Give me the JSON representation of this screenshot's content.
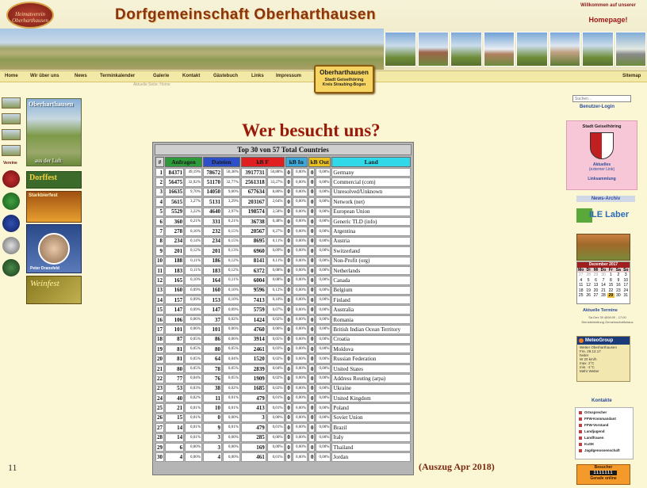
{
  "header": {
    "logo_text": "Heimatverein Oberharthausen",
    "title": "Dorfgemeinschaft Oberharthausen",
    "welcome": "Willkommen auf unserer",
    "homepage": "Homepage!"
  },
  "nav": {
    "items": [
      "Home",
      "Wir über uns",
      "News",
      "Terminkalender",
      "Galerie",
      "Kontakt",
      "Gästebuch",
      "Links",
      "Impressum"
    ],
    "sitemap": "Sitemap",
    "breadcrumb": "Aktuelle Seite: Home"
  },
  "place_box": {
    "title": "Oberharthausen",
    "sub1": "Stadt Geiselhöring",
    "sub2": "Kreis Straubing-Bogen"
  },
  "left": {
    "verein_label": "Vereine",
    "promo_village_title": "Oberharthausen",
    "promo_village_sub": "aus der Luft",
    "promo_dorffest": "Dorffest",
    "promo_starkbier": "Starkbierfest",
    "promo_preacher_name": "Peter Dransfeld",
    "promo_weinfest": "Weinfest"
  },
  "main": {
    "heading": "Wer besucht uns?",
    "excerpt_note": "(Auszug Apr 2018)",
    "page_number": "11"
  },
  "stats": {
    "title": "Top 30 von 57 Total Countries",
    "headers": {
      "rank": "#",
      "requests": "Anfragen",
      "files": "Dateien",
      "kbf": "kB F",
      "kbin": "kB In",
      "kbout": "kB Out",
      "land": "Land"
    },
    "rows": [
      {
        "n": "1",
        "req": "84371",
        "reqp": "49,19%",
        "files": "78672",
        "filesp": "50,38%",
        "kb": "3917731",
        "kbp": "50,88%",
        "in": "0",
        "inp": "0,00%",
        "out": "0",
        "outp": "0,00%",
        "land": "Germany"
      },
      {
        "n": "2",
        "req": "56475",
        "reqp": "32,92%",
        "files": "51170",
        "filesp": "32,77%",
        "kb": "2561318",
        "kbp": "33,27%",
        "in": "0",
        "inp": "0,00%",
        "out": "0",
        "outp": "0,00%",
        "land": "Commercial (com)"
      },
      {
        "n": "3",
        "req": "16635",
        "reqp": "9,70%",
        "files": "14050",
        "filesp": "9,00%",
        "kb": "677634",
        "kbp": "8,80%",
        "in": "0",
        "inp": "0,00%",
        "out": "0",
        "outp": "0,00%",
        "land": "Unresolved/Unknown"
      },
      {
        "n": "4",
        "req": "5615",
        "reqp": "3,27%",
        "files": "5131",
        "filesp": "3,29%",
        "kb": "203167",
        "kbp": "2,64%",
        "in": "0",
        "inp": "0,00%",
        "out": "0",
        "outp": "0,00%",
        "land": "Network (net)"
      },
      {
        "n": "5",
        "req": "5529",
        "reqp": "3,22%",
        "files": "4640",
        "filesp": "2,97%",
        "kb": "198574",
        "kbp": "2,58%",
        "in": "0",
        "inp": "0,00%",
        "out": "0",
        "outp": "0,00%",
        "land": "European Union"
      },
      {
        "n": "6",
        "req": "360",
        "reqp": "0,21%",
        "files": "331",
        "filesp": "0,21%",
        "kb": "36738",
        "kbp": "0,48%",
        "in": "0",
        "inp": "0,00%",
        "out": "0",
        "outp": "0,00%",
        "land": "Generic TLD (info)"
      },
      {
        "n": "7",
        "req": "278",
        "reqp": "0,16%",
        "files": "232",
        "filesp": "0,15%",
        "kb": "20567",
        "kbp": "0,27%",
        "in": "0",
        "inp": "0,00%",
        "out": "0",
        "outp": "0,00%",
        "land": "Argentina"
      },
      {
        "n": "8",
        "req": "234",
        "reqp": "0,14%",
        "files": "234",
        "filesp": "0,15%",
        "kb": "8695",
        "kbp": "0,11%",
        "in": "0",
        "inp": "0,00%",
        "out": "0",
        "outp": "0,00%",
        "land": "Austria"
      },
      {
        "n": "9",
        "req": "201",
        "reqp": "0,12%",
        "files": "201",
        "filesp": "0,13%",
        "kb": "6960",
        "kbp": "0,09%",
        "in": "0",
        "inp": "0,00%",
        "out": "0",
        "outp": "0,00%",
        "land": "Switzerland"
      },
      {
        "n": "10",
        "req": "188",
        "reqp": "0,11%",
        "files": "186",
        "filesp": "0,12%",
        "kb": "8141",
        "kbp": "0,11%",
        "in": "0",
        "inp": "0,00%",
        "out": "0",
        "outp": "0,00%",
        "land": "Non-Profit (org)"
      },
      {
        "n": "11",
        "req": "183",
        "reqp": "0,11%",
        "files": "183",
        "filesp": "0,12%",
        "kb": "6372",
        "kbp": "0,08%",
        "in": "0",
        "inp": "0,00%",
        "out": "0",
        "outp": "0,00%",
        "land": "Netherlands"
      },
      {
        "n": "12",
        "req": "165",
        "reqp": "0,10%",
        "files": "164",
        "filesp": "0,11%",
        "kb": "6004",
        "kbp": "0,08%",
        "in": "0",
        "inp": "0,00%",
        "out": "0",
        "outp": "0,00%",
        "land": "Canada"
      },
      {
        "n": "13",
        "req": "160",
        "reqp": "0,09%",
        "files": "160",
        "filesp": "0,10%",
        "kb": "9596",
        "kbp": "0,12%",
        "in": "0",
        "inp": "0,00%",
        "out": "0",
        "outp": "0,00%",
        "land": "Belgium"
      },
      {
        "n": "14",
        "req": "157",
        "reqp": "0,09%",
        "files": "153",
        "filesp": "0,10%",
        "kb": "7413",
        "kbp": "0,10%",
        "in": "0",
        "inp": "0,00%",
        "out": "0",
        "outp": "0,00%",
        "land": "Finland"
      },
      {
        "n": "15",
        "req": "147",
        "reqp": "0,09%",
        "files": "147",
        "filesp": "0,09%",
        "kb": "5759",
        "kbp": "0,07%",
        "in": "0",
        "inp": "0,00%",
        "out": "0",
        "outp": "0,00%",
        "land": "Australia"
      },
      {
        "n": "16",
        "req": "106",
        "reqp": "0,06%",
        "files": "37",
        "filesp": "0,02%",
        "kb": "1424",
        "kbp": "0,02%",
        "in": "0",
        "inp": "0,00%",
        "out": "0",
        "outp": "0,00%",
        "land": "Romania"
      },
      {
        "n": "17",
        "req": "101",
        "reqp": "0,06%",
        "files": "101",
        "filesp": "0,06%",
        "kb": "4760",
        "kbp": "0,06%",
        "in": "0",
        "inp": "0,00%",
        "out": "0",
        "outp": "0,00%",
        "land": "British Indian Ocean Territory"
      },
      {
        "n": "18",
        "req": "87",
        "reqp": "0,05%",
        "files": "86",
        "filesp": "0,06%",
        "kb": "3914",
        "kbp": "0,05%",
        "in": "0",
        "inp": "0,00%",
        "out": "0",
        "outp": "0,00%",
        "land": "Croatia"
      },
      {
        "n": "19",
        "req": "81",
        "reqp": "0,05%",
        "files": "80",
        "filesp": "0,05%",
        "kb": "2461",
        "kbp": "0,03%",
        "in": "0",
        "inp": "0,00%",
        "out": "0",
        "outp": "0,00%",
        "land": "Moldova"
      },
      {
        "n": "20",
        "req": "81",
        "reqp": "0,05%",
        "files": "64",
        "filesp": "0,04%",
        "kb": "1520",
        "kbp": "0,02%",
        "in": "0",
        "inp": "0,00%",
        "out": "0",
        "outp": "0,00%",
        "land": "Russian Federation"
      },
      {
        "n": "21",
        "req": "80",
        "reqp": "0,05%",
        "files": "78",
        "filesp": "0,05%",
        "kb": "2839",
        "kbp": "0,04%",
        "in": "0",
        "inp": "0,00%",
        "out": "0",
        "outp": "0,00%",
        "land": "United States"
      },
      {
        "n": "22",
        "req": "77",
        "reqp": "0,04%",
        "files": "76",
        "filesp": "0,05%",
        "kb": "1909",
        "kbp": "0,02%",
        "in": "0",
        "inp": "0,00%",
        "out": "0",
        "outp": "0,00%",
        "land": "Address Routing (arpa)"
      },
      {
        "n": "23",
        "req": "53",
        "reqp": "0,03%",
        "files": "38",
        "filesp": "0,02%",
        "kb": "1685",
        "kbp": "0,02%",
        "in": "0",
        "inp": "0,00%",
        "out": "0",
        "outp": "0,00%",
        "land": "Ukraine"
      },
      {
        "n": "24",
        "req": "40",
        "reqp": "0,02%",
        "files": "11",
        "filesp": "0,01%",
        "kb": "479",
        "kbp": "0,01%",
        "in": "0",
        "inp": "0,00%",
        "out": "0",
        "outp": "0,00%",
        "land": "United Kingdom"
      },
      {
        "n": "25",
        "req": "21",
        "reqp": "0,01%",
        "files": "10",
        "filesp": "0,01%",
        "kb": "413",
        "kbp": "0,01%",
        "in": "0",
        "inp": "0,00%",
        "out": "0",
        "outp": "0,00%",
        "land": "Poland"
      },
      {
        "n": "26",
        "req": "15",
        "reqp": "0,01%",
        "files": "0",
        "filesp": "0,00%",
        "kb": "3",
        "kbp": "0,00%",
        "in": "0",
        "inp": "0,00%",
        "out": "0",
        "outp": "0,00%",
        "land": "Soviet Union"
      },
      {
        "n": "27",
        "req": "14",
        "reqp": "0,01%",
        "files": "9",
        "filesp": "0,01%",
        "kb": "479",
        "kbp": "0,01%",
        "in": "0",
        "inp": "0,00%",
        "out": "0",
        "outp": "0,00%",
        "land": "Brazil"
      },
      {
        "n": "28",
        "req": "14",
        "reqp": "0,01%",
        "files": "3",
        "filesp": "0,00%",
        "kb": "285",
        "kbp": "0,00%",
        "in": "0",
        "inp": "0,00%",
        "out": "0",
        "outp": "0,00%",
        "land": "Italy"
      },
      {
        "n": "29",
        "req": "6",
        "reqp": "0,00%",
        "files": "3",
        "filesp": "0,00%",
        "kb": "169",
        "kbp": "0,00%",
        "in": "0",
        "inp": "0,00%",
        "out": "0",
        "outp": "0,00%",
        "land": "Thailand"
      },
      {
        "n": "30",
        "req": "4",
        "reqp": "0,00%",
        "files": "4",
        "filesp": "0,00%",
        "kb": "461",
        "kbp": "0,01%",
        "in": "0",
        "inp": "0,00%",
        "out": "0",
        "outp": "0,00%",
        "land": "Jordan"
      }
    ]
  },
  "right": {
    "search_placeholder": "Suchen...",
    "login": "Benutzer-Login",
    "muni_title": "Stadt Geiselhöring",
    "muni_link1": "Aktuelles",
    "muni_link2": "(externer Link)",
    "muni_link3": "Linksammlung",
    "news_archive": "News-Archiv",
    "ile_logo": "ILE Laber",
    "calendar_title": "Dezember 2017",
    "calendar_days": [
      "Mo",
      "Di",
      "Mi",
      "Do",
      "Fr",
      "Sa",
      "So"
    ],
    "calendar_cells": [
      "27",
      "28",
      "29",
      "30",
      "1",
      "2",
      "3",
      "4",
      "5",
      "6",
      "7",
      "8",
      "9",
      "10",
      "11",
      "12",
      "13",
      "14",
      "15",
      "16",
      "17",
      "18",
      "19",
      "20",
      "21",
      "22",
      "23",
      "24",
      "25",
      "26",
      "27",
      "28",
      "29",
      "30",
      "31"
    ],
    "appointments": "Aktuelle Termine",
    "appt_line1": "Sa Dez 30 @08:00 - 17:00",
    "appt_line2": "Diensteinteilung Gemeinschaftshaus",
    "weather_brand": "MeteoGroup",
    "weather_location": "Wetter Oberharthausen",
    "weather_date": "Fre, 29.12.17",
    "weather_state": "heiter",
    "weather_wind": "W 20 km/h",
    "weather_max": "max. 2°C",
    "weather_min": "min. -1°C",
    "weather_more": "Mehr Wetter",
    "kontakte_head": "Kontakte",
    "kontakte": [
      "Ortssprecher",
      "FFW-Kommandant",
      "FFW-Vorstand",
      "Landjugend",
      "Landfrauen",
      "KuSK",
      "Jagdgenossenschaft"
    ],
    "visitors_label": "Besucher",
    "visitors_counter": "1111111",
    "visitors_online": "Gerade online"
  }
}
